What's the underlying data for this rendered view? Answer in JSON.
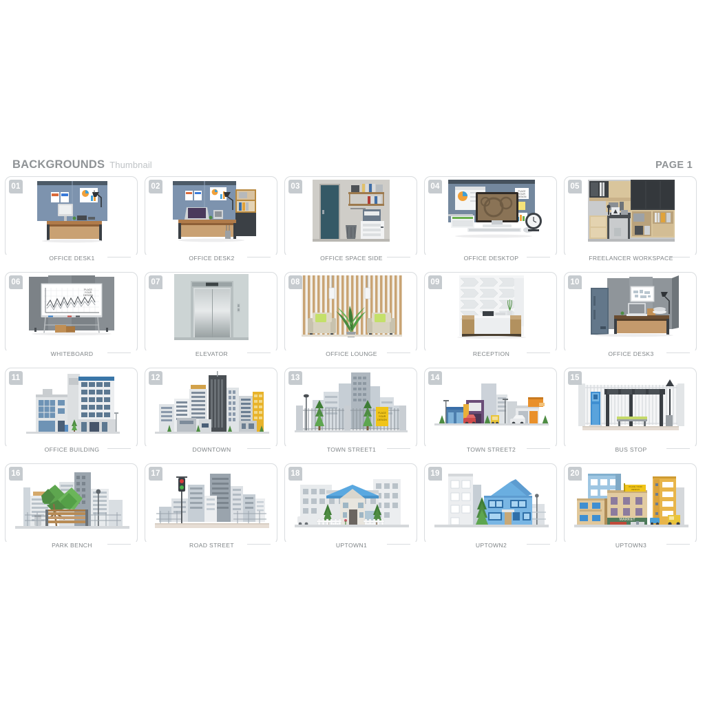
{
  "header": {
    "title": "BACKGROUNDS",
    "subtitle": "Thumbnail",
    "page_label": "PAGE 1"
  },
  "colors": {
    "background": "#ffffff",
    "card_border": "#d9dcdf",
    "badge_bg": "#c6cbcf",
    "title_text": "#8f9396",
    "subtitle_text": "#bfc3c6",
    "caption_text": "#7f8487"
  },
  "thumbnails": [
    {
      "number": "01",
      "label": "OFFICE DESK1",
      "scene": "office-desk1"
    },
    {
      "number": "02",
      "label": "OFFICE DESK2",
      "scene": "office-desk2"
    },
    {
      "number": "03",
      "label": "OFFICE SPACE SIDE",
      "scene": "office-space-side"
    },
    {
      "number": "04",
      "label": "OFFICE DESKTOP",
      "scene": "office-desktop"
    },
    {
      "number": "05",
      "label": "FREELANCER WORKSPACE",
      "scene": "freelancer-workspace"
    },
    {
      "number": "06",
      "label": "WHITEBOARD",
      "scene": "whiteboard"
    },
    {
      "number": "07",
      "label": "ELEVATOR",
      "scene": "elevator"
    },
    {
      "number": "08",
      "label": "OFFICE LOUNGE",
      "scene": "office-lounge"
    },
    {
      "number": "09",
      "label": "RECEPTION",
      "scene": "reception"
    },
    {
      "number": "10",
      "label": "OFFICE DESK3",
      "scene": "office-desk3"
    },
    {
      "number": "11",
      "label": "OFFICE BUILDING",
      "scene": "office-building"
    },
    {
      "number": "12",
      "label": "DOWNTOWN",
      "scene": "downtown"
    },
    {
      "number": "13",
      "label": "TOWN STREET1",
      "scene": "town-street1"
    },
    {
      "number": "14",
      "label": "TOWN STREET2",
      "scene": "town-street2"
    },
    {
      "number": "15",
      "label": "BUS STOP",
      "scene": "bus-stop"
    },
    {
      "number": "16",
      "label": "PARK BENCH",
      "scene": "park-bench"
    },
    {
      "number": "17",
      "label": "ROAD STREET",
      "scene": "road-street"
    },
    {
      "number": "18",
      "label": "UPTOWN1",
      "scene": "uptown1"
    },
    {
      "number": "19",
      "label": "UPTOWN2",
      "scene": "uptown2"
    },
    {
      "number": "20",
      "label": "UPTOWN3",
      "scene": "uptown3"
    }
  ],
  "artwork_text": {
    "whiteboard_placeholder": "PLACE YOUR DESIGN",
    "desktop_placeholder": "PLACE YOUR DESIGN",
    "street_sign_placeholder": "PLACE YOUR DESIGN",
    "market_sign": "MARKET"
  }
}
